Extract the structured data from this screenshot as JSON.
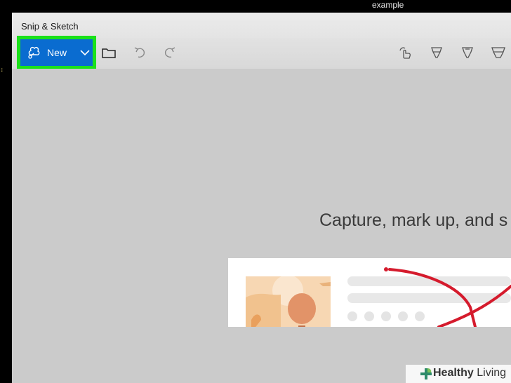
{
  "screen": {
    "top_label": "example"
  },
  "window": {
    "title": "Snip & Sketch"
  },
  "toolbar": {
    "new_label": "New",
    "icons": [
      "snip-icon",
      "chevron-down-icon",
      "folder-icon",
      "undo-icon",
      "redo-icon",
      "touch-writing-icon",
      "ballpoint-pen-icon",
      "pencil-icon",
      "highlighter-icon"
    ],
    "accent_color": "#0a6cd0",
    "highlight_outline_color": "#1be11b"
  },
  "canvas": {
    "tagline": "Capture, mark up, and s"
  },
  "watermark": {
    "brand_bold": "Healthy",
    "brand_rest": " Living"
  }
}
